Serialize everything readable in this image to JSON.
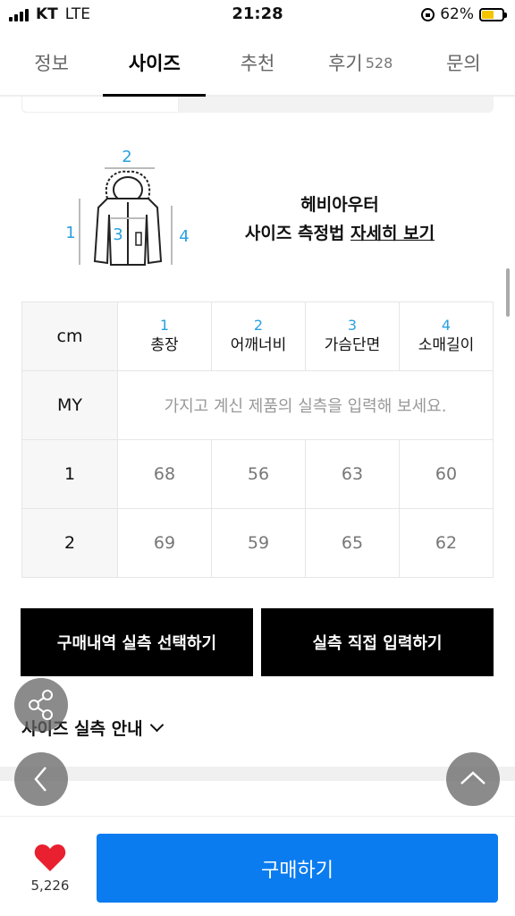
{
  "status_bar": {
    "carrier": "KT",
    "network": "LTE",
    "time": "21:28",
    "battery": "62%"
  },
  "tabs": [
    {
      "label": "정보"
    },
    {
      "label": "사이즈"
    },
    {
      "label": "추천"
    },
    {
      "label": "후기",
      "count": "528"
    },
    {
      "label": "문의"
    }
  ],
  "guide": {
    "product": "헤비아우터",
    "prefix": "사이즈 측정법",
    "link": "자세히 보기",
    "markers": [
      "1",
      "2",
      "3",
      "4"
    ]
  },
  "table": {
    "unit": "cm",
    "columns": [
      {
        "num": "1",
        "label": "총장"
      },
      {
        "num": "2",
        "label": "어깨너비"
      },
      {
        "num": "3",
        "label": "가슴단면"
      },
      {
        "num": "4",
        "label": "소매길이"
      }
    ],
    "my_label": "MY",
    "my_placeholder": "가지고 계신 제품의 실측을 입력해 보세요.",
    "rows": [
      {
        "size": "1",
        "values": [
          "68",
          "56",
          "63",
          "60"
        ]
      },
      {
        "size": "2",
        "values": [
          "69",
          "59",
          "65",
          "62"
        ]
      }
    ]
  },
  "buttons": {
    "select_purchase": "구매내역 실측 선택하기",
    "direct_input": "실측 직접 입력하기"
  },
  "size_info_toggle": "사이즈 실측 안내",
  "bottom": {
    "like_count": "5,226",
    "buy": "구매하기"
  },
  "colors": {
    "accent_blue": "#0a7cf0",
    "marker_blue": "#2aa0df",
    "heart_red": "#e8202f"
  }
}
